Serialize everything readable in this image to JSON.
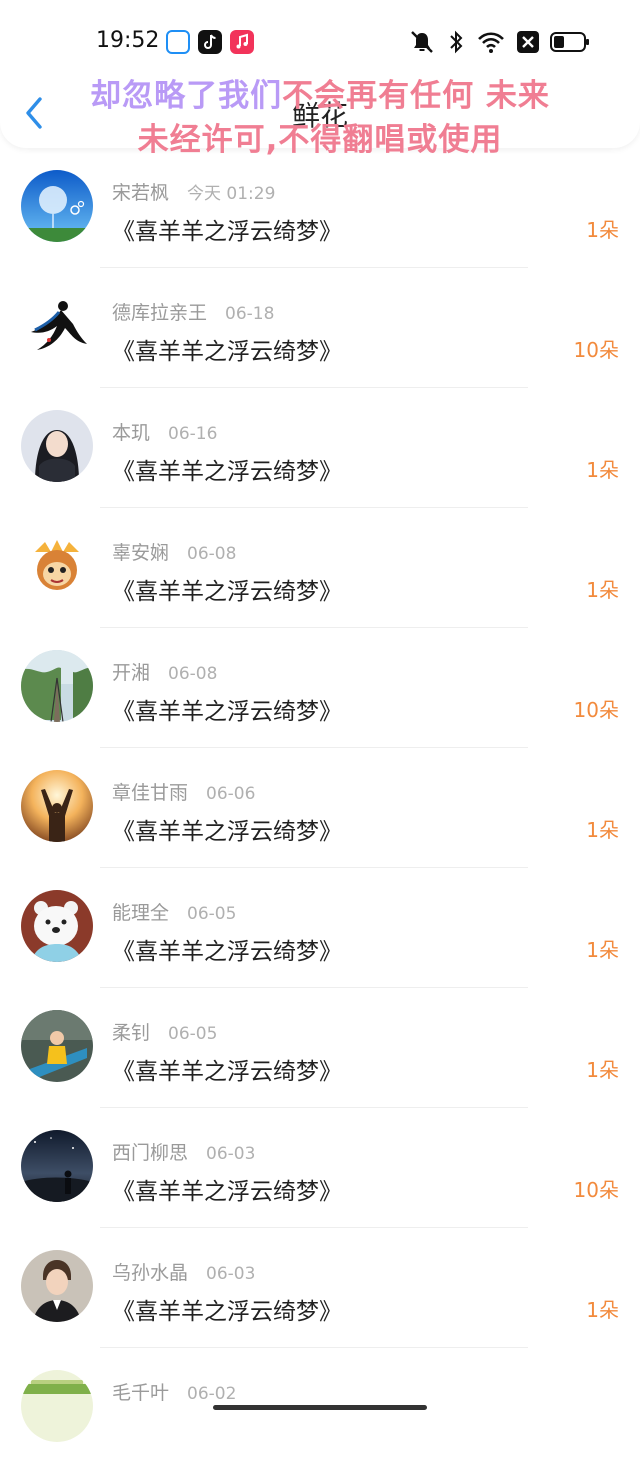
{
  "status_bar": {
    "time": "19:52"
  },
  "header": {
    "title": "鲜花"
  },
  "watermark": {
    "line1_a": "却忽略了我们",
    "line1_b": "不会再有任何 未来",
    "line2": "未经许可,不得翻唱或使用"
  },
  "gifts": [
    {
      "user": "宋若枫",
      "date": "今天 01:29",
      "song": "《喜羊羊之浮云绮梦》",
      "count": "1朵",
      "avatar": "dandelion-avatar"
    },
    {
      "user": "德库拉亲王",
      "date": "06-18",
      "song": "《喜羊羊之浮云绮梦》",
      "count": "10朵",
      "avatar": "dancer-avatar"
    },
    {
      "user": "本玑",
      "date": "06-16",
      "song": "《喜羊羊之浮云绮梦》",
      "count": "1朵",
      "avatar": "girl-avatar"
    },
    {
      "user": "辜安娴",
      "date": "06-08",
      "song": "《喜羊羊之浮云绮梦》",
      "count": "1朵",
      "avatar": "monkey-avatar"
    },
    {
      "user": "开湘",
      "date": "06-08",
      "song": "《喜羊羊之浮云绮梦》",
      "count": "10朵",
      "avatar": "railway-avatar"
    },
    {
      "user": "章佳甘雨",
      "date": "06-06",
      "song": "《喜羊羊之浮云绮梦》",
      "count": "1朵",
      "avatar": "sunset-avatar"
    },
    {
      "user": "能理全",
      "date": "06-05",
      "song": "《喜羊羊之浮云绮梦》",
      "count": "1朵",
      "avatar": "bear-avatar"
    },
    {
      "user": "柔钊",
      "date": "06-05",
      "song": "《喜羊羊之浮云绮梦》",
      "count": "1朵",
      "avatar": "child-avatar"
    },
    {
      "user": "西门柳思",
      "date": "06-03",
      "song": "《喜羊羊之浮云绮梦》",
      "count": "10朵",
      "avatar": "night-sky-avatar"
    },
    {
      "user": "乌孙水晶",
      "date": "06-03",
      "song": "《喜羊羊之浮云绮梦》",
      "count": "1朵",
      "avatar": "boy-avatar"
    },
    {
      "user": "毛千叶",
      "date": "06-02",
      "song": "",
      "count": "",
      "avatar": "landscape-avatar"
    }
  ]
}
